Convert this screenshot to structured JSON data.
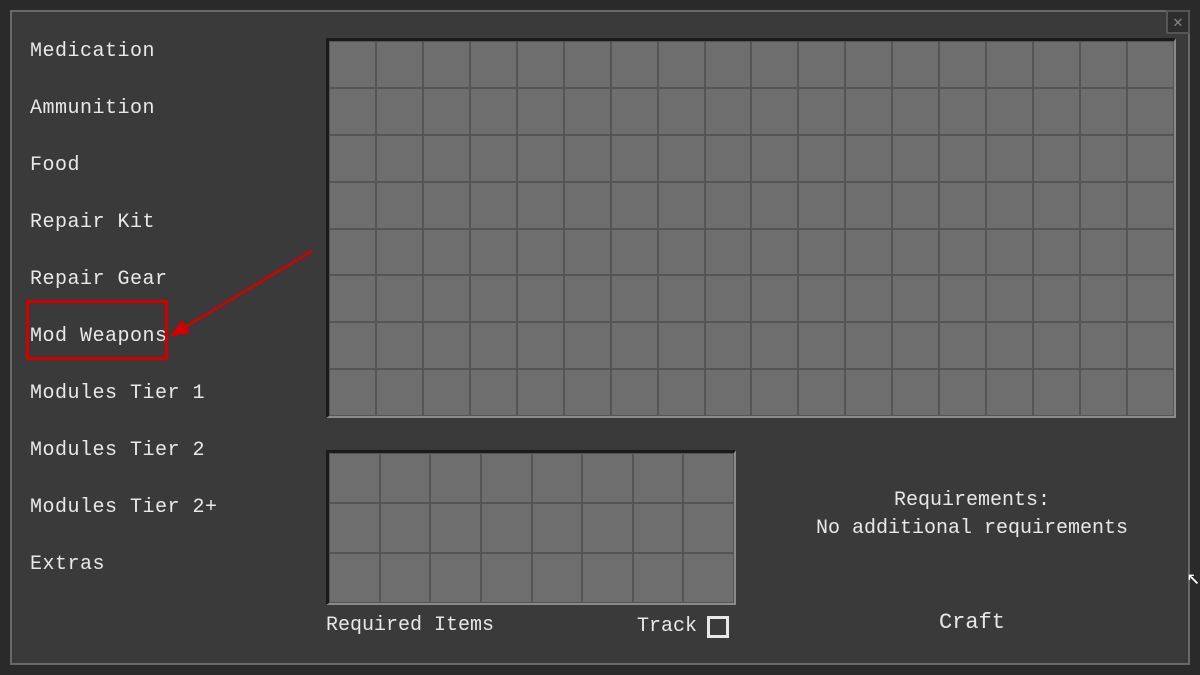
{
  "sidebar": {
    "items": [
      {
        "label": "Medication"
      },
      {
        "label": "Ammunition"
      },
      {
        "label": "Food"
      },
      {
        "label": "Repair Kit"
      },
      {
        "label": "Repair Gear"
      },
      {
        "label": "Mod Weapons"
      },
      {
        "label": "Modules Tier 1"
      },
      {
        "label": "Modules Tier 2"
      },
      {
        "label": "Modules Tier 2+"
      },
      {
        "label": "Extras"
      }
    ],
    "highlighted_index": 5
  },
  "main_grid": {
    "cols": 18,
    "rows": 8
  },
  "required_grid": {
    "cols": 8,
    "rows": 3
  },
  "labels": {
    "required_items": "Required Items",
    "track": "Track",
    "requirements_title": "Requirements:",
    "requirements_text": "No additional requirements",
    "craft": "Craft"
  },
  "track_checked": false,
  "colors": {
    "highlight": "#d40000",
    "panel_bg": "#3a3a3a",
    "grid_bg": "#6e6e6e",
    "text": "#e8e8e8"
  }
}
